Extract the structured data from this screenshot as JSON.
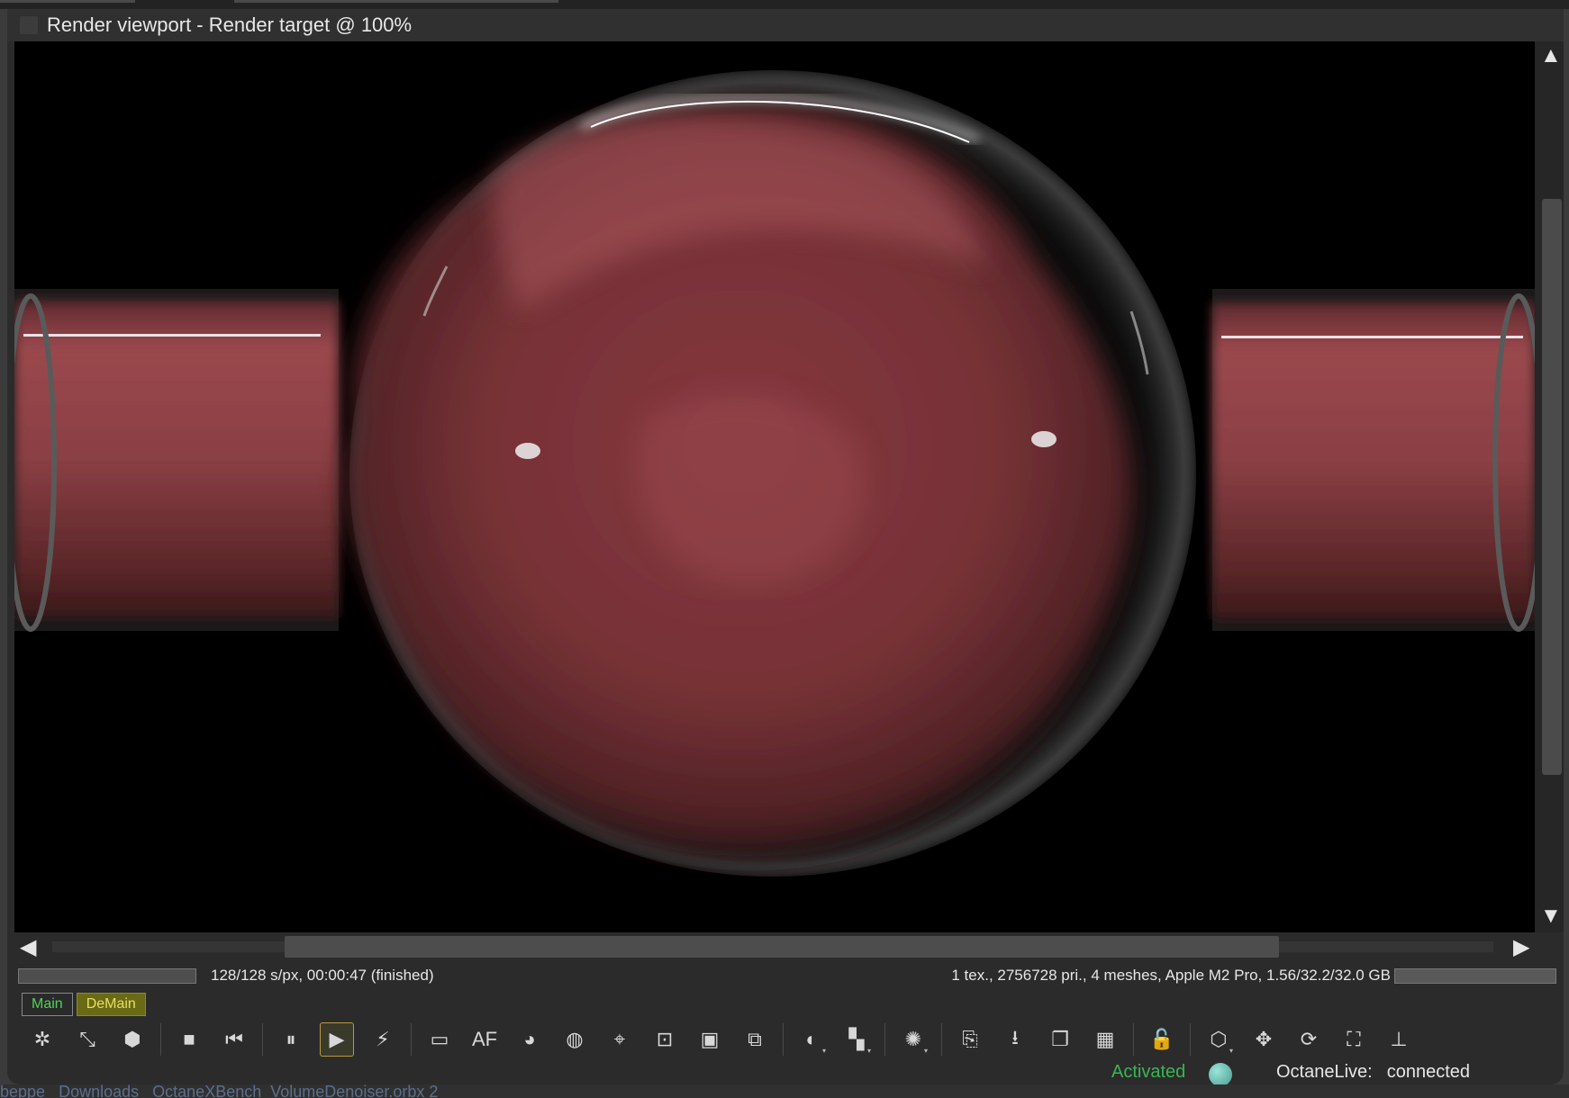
{
  "window": {
    "title": "Render viewport - Render target @ 100%"
  },
  "status": {
    "progress_fraction": 1.0,
    "progress_text": "128/128 s/px, 00:00:47 (finished)",
    "scene_stats": "1 tex., 2756728 pri., 4 meshes, Apple M2 Pro, 1.56/32.2/32.0 GB",
    "gpu_memory_fraction": 1.0
  },
  "tabs": [
    {
      "label": "Main",
      "active": false
    },
    {
      "label": "DeMain",
      "active": true
    }
  ],
  "toolbar": {
    "items": [
      {
        "name": "recenter-view-icon",
        "glyph": "✲"
      },
      {
        "name": "region-render-icon",
        "glyph": "⤡"
      },
      {
        "name": "object-picker-icon",
        "glyph": "⬢"
      },
      {
        "sep": true
      },
      {
        "name": "stop-render-icon",
        "glyph": "■"
      },
      {
        "name": "restart-render-icon",
        "glyph": "⏮"
      },
      {
        "sep": true
      },
      {
        "name": "pause-render-icon",
        "glyph": "⏸"
      },
      {
        "name": "start-render-icon",
        "glyph": "▶",
        "active": true
      },
      {
        "name": "realtime-render-icon",
        "glyph": "⚡"
      },
      {
        "sep": true
      },
      {
        "name": "display-settings-icon",
        "glyph": "▭"
      },
      {
        "name": "autofocus-icon",
        "glyph": "AF"
      },
      {
        "name": "white-balance-icon",
        "glyph": "◕"
      },
      {
        "name": "material-picker-icon",
        "glyph": "◍"
      },
      {
        "name": "pick-focus-icon",
        "glyph": "⌖"
      },
      {
        "name": "camera-picker-icon",
        "glyph": "⊡"
      },
      {
        "name": "render-region-icon",
        "glyph": "▣"
      },
      {
        "name": "film-region-icon",
        "glyph": "⧉"
      },
      {
        "sep": true
      },
      {
        "name": "clay-mode-icon",
        "glyph": "◐",
        "dropdown": true
      },
      {
        "name": "subsampling-icon",
        "glyph": "▚",
        "dropdown": true
      },
      {
        "sep": true
      },
      {
        "name": "decal-wireframe-icon",
        "glyph": "✺",
        "dropdown": true
      },
      {
        "sep": true
      },
      {
        "name": "copy-to-clipboard-icon",
        "glyph": "⎘"
      },
      {
        "name": "save-render-icon",
        "glyph": "⭳"
      },
      {
        "name": "save-passes-icon",
        "glyph": "❐"
      },
      {
        "name": "alpha-background-icon",
        "glyph": "▦"
      },
      {
        "sep": true
      },
      {
        "name": "lock-viewport-icon",
        "glyph": "🔓"
      },
      {
        "sep": true
      },
      {
        "name": "gizmo-select-icon",
        "glyph": "⬡",
        "dropdown": true
      },
      {
        "name": "gizmo-move-icon",
        "glyph": "✥"
      },
      {
        "name": "gizmo-rotate-icon",
        "glyph": "⟳"
      },
      {
        "name": "gizmo-scale-icon",
        "glyph": "⛶"
      },
      {
        "name": "world-axis-icon",
        "glyph": "⊥"
      }
    ]
  },
  "footer": {
    "activated_label": "Activated",
    "live_label": "OctaneLive:",
    "live_status": "connected"
  },
  "finder_breadcrumb": [
    "beppe",
    "Downloads",
    "OctaneXBench_VolumeDenoiser.orbx 2"
  ],
  "colors": {
    "activated": "#3ab554",
    "tab_active": "#6a6a16",
    "tab_text": "#55d05a",
    "volume_red": "#a04a50"
  }
}
